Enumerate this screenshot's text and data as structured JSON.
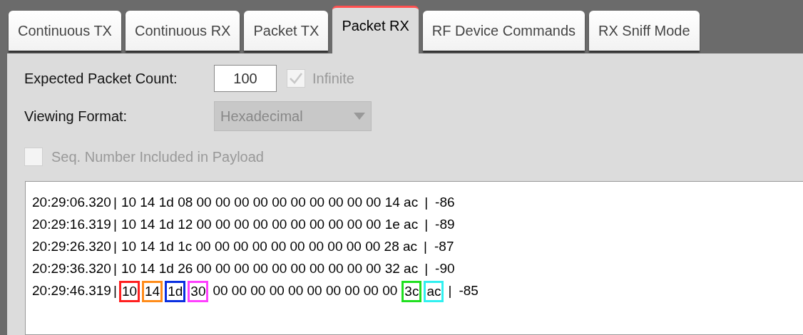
{
  "tabs": [
    {
      "label": "Continuous TX",
      "selected": false
    },
    {
      "label": "Continuous RX",
      "selected": false
    },
    {
      "label": "Packet TX",
      "selected": false
    },
    {
      "label": "Packet RX",
      "selected": true
    },
    {
      "label": "RF Device Commands",
      "selected": false
    },
    {
      "label": "RX Sniff Mode",
      "selected": false
    }
  ],
  "packet_count": {
    "label": "Expected Packet Count:",
    "value": "100",
    "infinite": {
      "label": "Infinite",
      "checked": true,
      "disabled": true
    }
  },
  "viewing_format": {
    "label": "Viewing Format:",
    "value": "Hexadecimal",
    "disabled": true
  },
  "seq_number": {
    "label": "Seq. Number Included in Payload",
    "checked": false,
    "disabled": true
  },
  "log": [
    {
      "time": "20:29:06.320",
      "separator_1": "|",
      "bytes": [
        {
          "text": "10"
        },
        {
          "text": "14"
        },
        {
          "text": "1d"
        },
        {
          "text": "08"
        },
        {
          "text": "00"
        },
        {
          "text": "00"
        },
        {
          "text": "00"
        },
        {
          "text": "00"
        },
        {
          "text": "00"
        },
        {
          "text": "00"
        },
        {
          "text": "00"
        },
        {
          "text": "00"
        },
        {
          "text": "00"
        },
        {
          "text": "00"
        },
        {
          "text": "14"
        },
        {
          "text": "ac"
        }
      ],
      "separator_2": "|",
      "rssi": "-86"
    },
    {
      "time": "20:29:16.319",
      "separator_1": "|",
      "bytes": [
        {
          "text": "10"
        },
        {
          "text": "14"
        },
        {
          "text": "1d"
        },
        {
          "text": "12"
        },
        {
          "text": "00"
        },
        {
          "text": "00"
        },
        {
          "text": "00"
        },
        {
          "text": "00"
        },
        {
          "text": "00"
        },
        {
          "text": "00"
        },
        {
          "text": "00"
        },
        {
          "text": "00"
        },
        {
          "text": "00"
        },
        {
          "text": "00"
        },
        {
          "text": "1e"
        },
        {
          "text": "ac"
        }
      ],
      "separator_2": "|",
      "rssi": "-89"
    },
    {
      "time": "20:29:26.320",
      "separator_1": "|",
      "bytes": [
        {
          "text": "10"
        },
        {
          "text": "14"
        },
        {
          "text": "1d"
        },
        {
          "text": "1c"
        },
        {
          "text": "00"
        },
        {
          "text": "00"
        },
        {
          "text": "00"
        },
        {
          "text": "00"
        },
        {
          "text": "00"
        },
        {
          "text": "00"
        },
        {
          "text": "00"
        },
        {
          "text": "00"
        },
        {
          "text": "00"
        },
        {
          "text": "00"
        },
        {
          "text": "28"
        },
        {
          "text": "ac"
        }
      ],
      "separator_2": "|",
      "rssi": "-87"
    },
    {
      "time": "20:29:36.320",
      "separator_1": "|",
      "bytes": [
        {
          "text": "10"
        },
        {
          "text": "14"
        },
        {
          "text": "1d"
        },
        {
          "text": "26"
        },
        {
          "text": "00"
        },
        {
          "text": "00"
        },
        {
          "text": "00"
        },
        {
          "text": "00"
        },
        {
          "text": "00"
        },
        {
          "text": "00"
        },
        {
          "text": "00"
        },
        {
          "text": "00"
        },
        {
          "text": "00"
        },
        {
          "text": "00"
        },
        {
          "text": "32"
        },
        {
          "text": "ac"
        }
      ],
      "separator_2": "|",
      "rssi": "-90"
    },
    {
      "time": "20:29:46.319",
      "separator_1": "|",
      "bytes": [
        {
          "text": "10",
          "color": "#ff2020"
        },
        {
          "text": "14",
          "color": "#ff8c1a"
        },
        {
          "text": "1d",
          "color": "#0a2fe0"
        },
        {
          "text": "30",
          "color": "#ff40ff"
        },
        {
          "text": "00"
        },
        {
          "text": "00"
        },
        {
          "text": "00"
        },
        {
          "text": "00"
        },
        {
          "text": "00"
        },
        {
          "text": "00"
        },
        {
          "text": "00"
        },
        {
          "text": "00"
        },
        {
          "text": "00"
        },
        {
          "text": "00"
        },
        {
          "text": "3c",
          "color": "#20e020"
        },
        {
          "text": "ac",
          "color": "#30f0f0"
        }
      ],
      "separator_2": "|",
      "rssi": "-85"
    }
  ]
}
